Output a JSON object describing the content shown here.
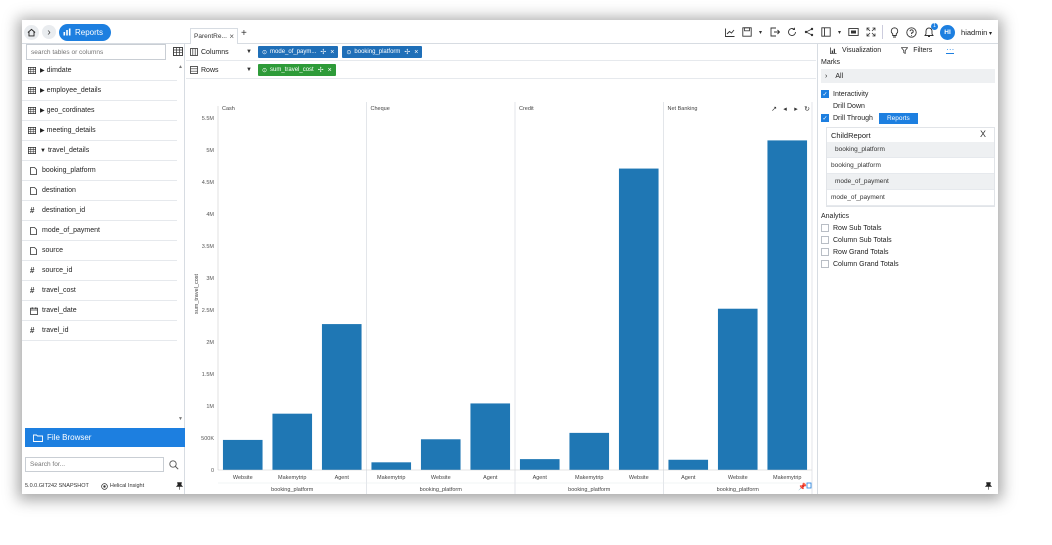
{
  "topbar": {
    "reports_label": "Reports",
    "tab_label": "ParentRe...",
    "tab_close": "×",
    "tab_add": "+",
    "notification_count": "1",
    "avatar_initials": "HI",
    "username": "hiadmin"
  },
  "left": {
    "search_placeholder": "search tables or columns",
    "fields": [
      {
        "icon": "table-icon",
        "expanded": false,
        "label": "dimdate"
      },
      {
        "icon": "table-icon",
        "expanded": false,
        "label": "employee_details"
      },
      {
        "icon": "table-icon",
        "expanded": false,
        "label": "geo_cordinates"
      },
      {
        "icon": "table-icon",
        "expanded": false,
        "label": "meeting_details"
      },
      {
        "icon": "table-icon",
        "expanded": true,
        "label": "travel_details"
      },
      {
        "icon": "text-field-icon",
        "label": "booking_platform"
      },
      {
        "icon": "text-field-icon",
        "label": "destination"
      },
      {
        "icon": "number-field-icon",
        "label": "destination_id"
      },
      {
        "icon": "text-field-icon",
        "label": "mode_of_payment"
      },
      {
        "icon": "text-field-icon",
        "label": "source"
      },
      {
        "icon": "number-field-icon",
        "label": "source_id"
      },
      {
        "icon": "number-field-icon",
        "label": "travel_cost"
      },
      {
        "icon": "date-field-icon",
        "label": "travel_date"
      },
      {
        "icon": "number-field-icon",
        "label": "travel_id"
      }
    ],
    "file_browser_label": "File Browser",
    "search2_placeholder": "Search for...",
    "version": "5.0.0.GIT242 SNAPSHOT",
    "brand": "Helical Insight"
  },
  "shelves": {
    "columns_label": "Columns",
    "rows_label": "Rows",
    "column_pills": [
      "mode_of_paym...",
      "booking_platform"
    ],
    "row_pills": [
      "sum_travel_cost"
    ]
  },
  "right": {
    "tab_visualization": "Visualization",
    "tab_filters": "Filters",
    "tab_more": "···",
    "marks_label": "Marks",
    "all_label": "All",
    "interactivity_label": "Interactivity",
    "drill_down_label": "Drill Down",
    "drill_through_label": "Drill Through",
    "reports_tag": "Reports",
    "child_report_label": "ChildReport",
    "close": "X",
    "mapping": [
      {
        "label": "booking_platform",
        "shaded": true
      },
      {
        "label": "booking_platform",
        "shaded": false
      },
      {
        "label": "mode_of_payment",
        "shaded": true
      },
      {
        "label": "mode_of_payment",
        "shaded": false
      }
    ],
    "analytics_label": "Analytics",
    "analytics_options": [
      "Row Sub Totals",
      "Column Sub Totals",
      "Row Grand Totals",
      "Column Grand Totals"
    ]
  },
  "chart_data": {
    "type": "bar",
    "ylabel": "sum_travel_cost",
    "xlabel": "booking_platform",
    "ylim": [
      0,
      5500000
    ],
    "yticks": [
      "0",
      "500K",
      "1M",
      "1.5M",
      "2M",
      "2.5M",
      "3M",
      "3.5M",
      "4M",
      "4.5M",
      "5M",
      "5.5M"
    ],
    "panels": [
      {
        "name": "Cash",
        "categories": [
          "Website",
          "Makemytrip",
          "Agent"
        ],
        "values": [
          470000,
          880000,
          2280000
        ]
      },
      {
        "name": "Cheque",
        "categories": [
          "Makemytrip",
          "Website",
          "Agent"
        ],
        "values": [
          120000,
          480000,
          1040000
        ]
      },
      {
        "name": "Credit",
        "categories": [
          "Agent",
          "Makemytrip",
          "Website"
        ],
        "values": [
          170000,
          580000,
          4710000
        ]
      },
      {
        "name": "Net Banking",
        "categories": [
          "Agent",
          "Website",
          "Makemytrip"
        ],
        "values": [
          160000,
          2520000,
          5150000
        ]
      }
    ],
    "bar_color": "#1f77b4"
  }
}
